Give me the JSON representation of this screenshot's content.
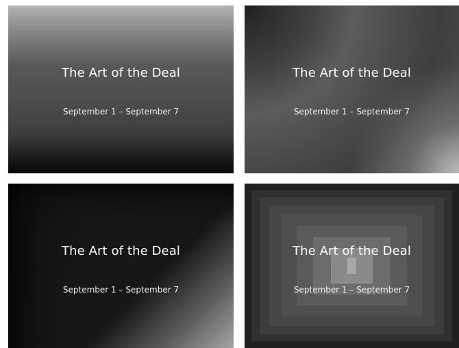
{
  "slides": [
    {
      "title": "The Art of the Deal",
      "subtitle": "September 1 – September 7",
      "fill": "linear gradient (vertical)"
    },
    {
      "title": "The Art of the Deal",
      "subtitle": "September 1 – September 7",
      "fill": "radial gradient"
    },
    {
      "title": "The Art of the Deal",
      "subtitle": "September 1 – September 7",
      "fill": "rectangular gradient (from corner)"
    },
    {
      "title": "The Art of the Deal",
      "subtitle": "September 1 – September 7",
      "fill": "rectangular gradient (from center)"
    }
  ],
  "colors": {
    "background": "#ffffff",
    "text": "#ffffff"
  }
}
